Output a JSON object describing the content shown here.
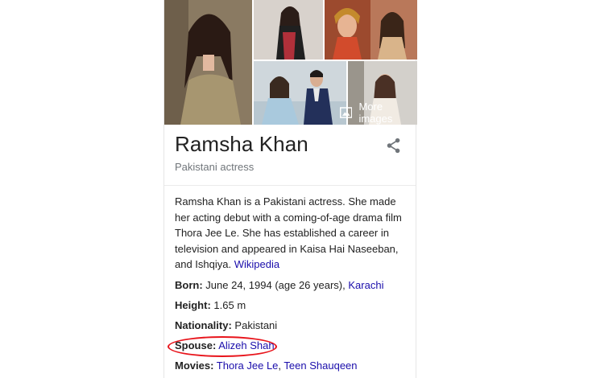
{
  "panel": {
    "more_images_label": "More images",
    "title": "Ramsha Khan",
    "subtitle": "Pakistani actress",
    "description": "Ramsha Khan is a Pakistani actress. She made her acting debut with a coming-of-age drama film Thora Jee Le. She has established a career in television and appeared in Kaisa Hai Naseeban, and Ishqiya.",
    "source_link": "Wikipedia",
    "facts": {
      "born_label": "Born:",
      "born_value": "June 24, 1994 (age 26 years),",
      "born_place": "Karachi",
      "height_label": "Height:",
      "height_value": "1.65 m",
      "nationality_label": "Nationality:",
      "nationality_value": "Pakistani",
      "spouse_label": "Spouse:",
      "spouse_value": "Alizeh Shah",
      "movies_label": "Movies:",
      "movies_1": "Thora Jee Le",
      "movies_sep": ",",
      "movies_2": "Teen Shauqeen"
    }
  },
  "icons": {
    "share": "share-icon",
    "more_images": "image-icon"
  },
  "colors": {
    "link": "#1a0dab",
    "annotation": "#e8141b",
    "subtitle": "#70757a"
  }
}
